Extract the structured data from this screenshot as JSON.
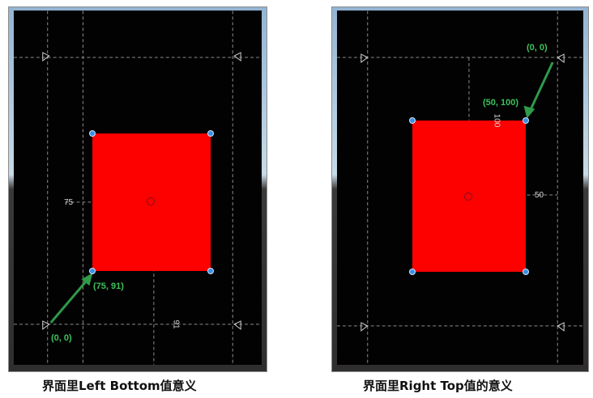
{
  "left_panel": {
    "caption": "界面里Left Bottom值意义",
    "offset_label": "75",
    "bottom_label": "91",
    "corner_label": "(75, 91)",
    "origin_label": "(0, 0)"
  },
  "right_panel": {
    "caption": "界面里Right Top值的意义",
    "offset_label": "50",
    "top_label": "100",
    "corner_label": "(50, 100)",
    "origin_label": "(0, 0)"
  },
  "colors": {
    "rect": "#fd0000",
    "arrow": "#2f9a4a",
    "annotation_text": "#3cc25c",
    "handle": "#3a8fe0",
    "guide": "#8a8a8a"
  }
}
